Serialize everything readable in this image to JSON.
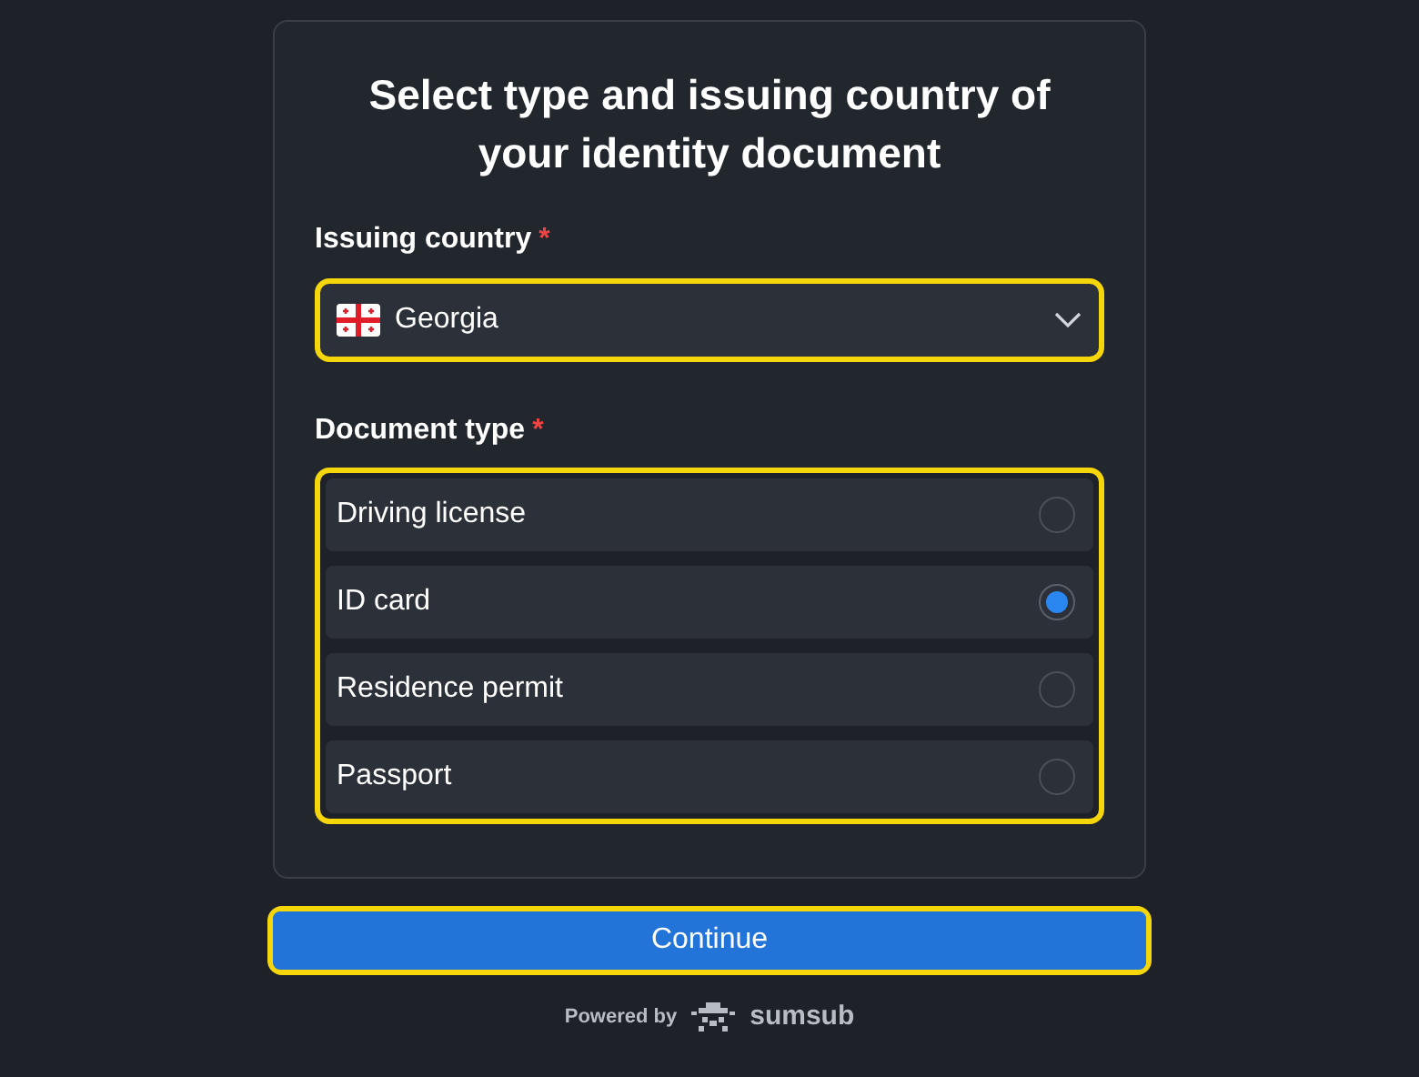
{
  "title": "Select type and issuing country of your identity document",
  "country_field": {
    "label": "Issuing country",
    "required_mark": "*",
    "value": "Georgia"
  },
  "document_type": {
    "label": "Document type",
    "required_mark": "*",
    "options": [
      {
        "label": "Driving license",
        "selected": false
      },
      {
        "label": "ID card",
        "selected": true
      },
      {
        "label": "Residence permit",
        "selected": false
      },
      {
        "label": "Passport",
        "selected": false
      }
    ]
  },
  "continue_button": "Continue",
  "footer": {
    "powered_by": "Powered by",
    "brand": "sumsub"
  }
}
